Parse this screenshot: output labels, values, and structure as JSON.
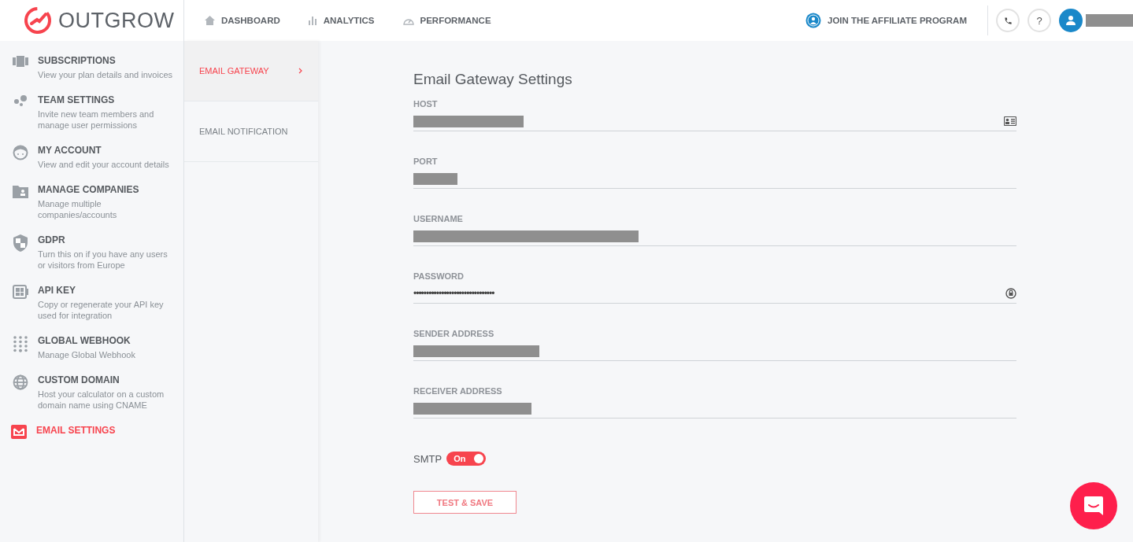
{
  "header": {
    "brand": "OUTGROW",
    "nav": [
      {
        "label": "DASHBOARD",
        "selected": false
      },
      {
        "label": "ANALYTICS",
        "selected": false
      },
      {
        "label": "PERFORMANCE",
        "selected": false
      }
    ],
    "affiliate": "JOIN THE AFFILIATE PROGRAM",
    "help": "?",
    "user_redacted": true
  },
  "sidebar": {
    "items": [
      {
        "title": "SUBSCRIPTIONS",
        "description": "View your plan details and invoices",
        "selected": false
      },
      {
        "title": "TEAM SETTINGS",
        "description": "Invite new team members and manage user permissions",
        "selected": false
      },
      {
        "title": "MY ACCOUNT",
        "description": "View and edit your account details",
        "selected": false
      },
      {
        "title": "MANAGE COMPANIES",
        "description": "Manage multiple companies/accounts",
        "selected": false
      },
      {
        "title": "GDPR",
        "description": "Turn this on if you have any users or visitors from Europe",
        "selected": false
      },
      {
        "title": "API KEY",
        "description": "Copy or regenerate your API key used for integration",
        "selected": false
      },
      {
        "title": "GLOBAL WEBHOOK",
        "description": "Manage Global Webhook",
        "selected": false
      },
      {
        "title": "CUSTOM DOMAIN",
        "description": "Host your calculator on a custom domain name using CNAME",
        "selected": false
      },
      {
        "title": "EMAIL SETTINGS",
        "selected": true
      }
    ]
  },
  "subnav": {
    "items": [
      {
        "label": "EMAIL GATEWAY",
        "selected": true
      },
      {
        "label": "EMAIL NOTIFICATION",
        "selected": false
      }
    ]
  },
  "form": {
    "title": "Email Gateway Settings",
    "fields": [
      {
        "label": "HOST",
        "redacted": true
      },
      {
        "label": "PORT",
        "redacted": true
      },
      {
        "label": "USERNAME",
        "redacted": true
      },
      {
        "label": "PASSWORD",
        "redacted": false,
        "value": "••••••••••••••••••••••••••••••••"
      },
      {
        "label": "SENDER ADDRESS",
        "redacted": true
      },
      {
        "label": "RECEIVER ADDRESS",
        "redacted": true
      }
    ],
    "smtp": {
      "label": "SMTP",
      "on": true,
      "state_text": "On"
    },
    "button": "TEST & SAVE"
  }
}
